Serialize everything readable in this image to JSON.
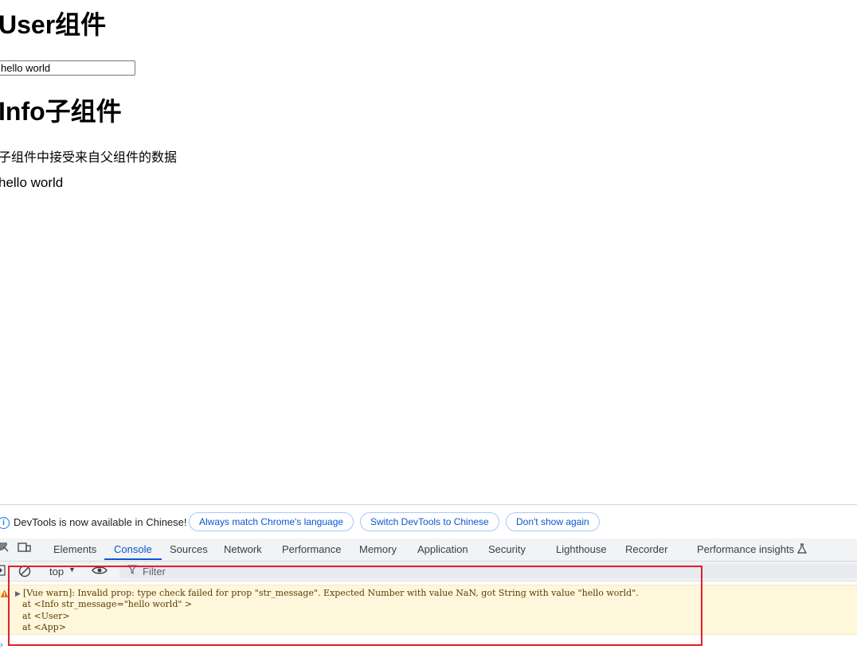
{
  "page": {
    "user_heading": "User组件",
    "input_value": "hello world",
    "info_heading": "Info子组件",
    "description": "子组件中接受来自父组件的数据",
    "message": "hello world"
  },
  "devtools": {
    "infobar": {
      "text": "DevTools is now available in Chinese!",
      "btn_match": "Always match Chrome's language",
      "btn_switch": "Switch DevTools to Chinese",
      "btn_dismiss": "Don't show again"
    },
    "tabs": [
      "Elements",
      "Console",
      "Sources",
      "Network",
      "Performance",
      "Memory",
      "Application",
      "Security",
      "Lighthouse",
      "Recorder",
      "Performance insights"
    ],
    "active_tab": "Console",
    "toolbar": {
      "context": "top",
      "filter_placeholder": "Filter"
    },
    "warning": {
      "line1": "[Vue warn]: Invalid prop: type check failed for prop \"str_message\". Expected Number with value NaN, got String with value \"hello world\".",
      "line2": "at <Info str_message=\"hello world\" >",
      "line3": "at <User>",
      "line4": "at <App>"
    }
  },
  "icons": {
    "info": "info-icon",
    "inspect": "inspect-element-icon",
    "device": "device-toolbar-icon",
    "clear": "clear-console-icon",
    "eye": "live-expression-icon",
    "filter": "filter-icon",
    "warning": "warning-icon",
    "flask": "experiment-icon"
  },
  "colors": {
    "accent": "#0b57d0",
    "warning_bg": "#fef7dc",
    "highlight_box": "#e0202a"
  }
}
